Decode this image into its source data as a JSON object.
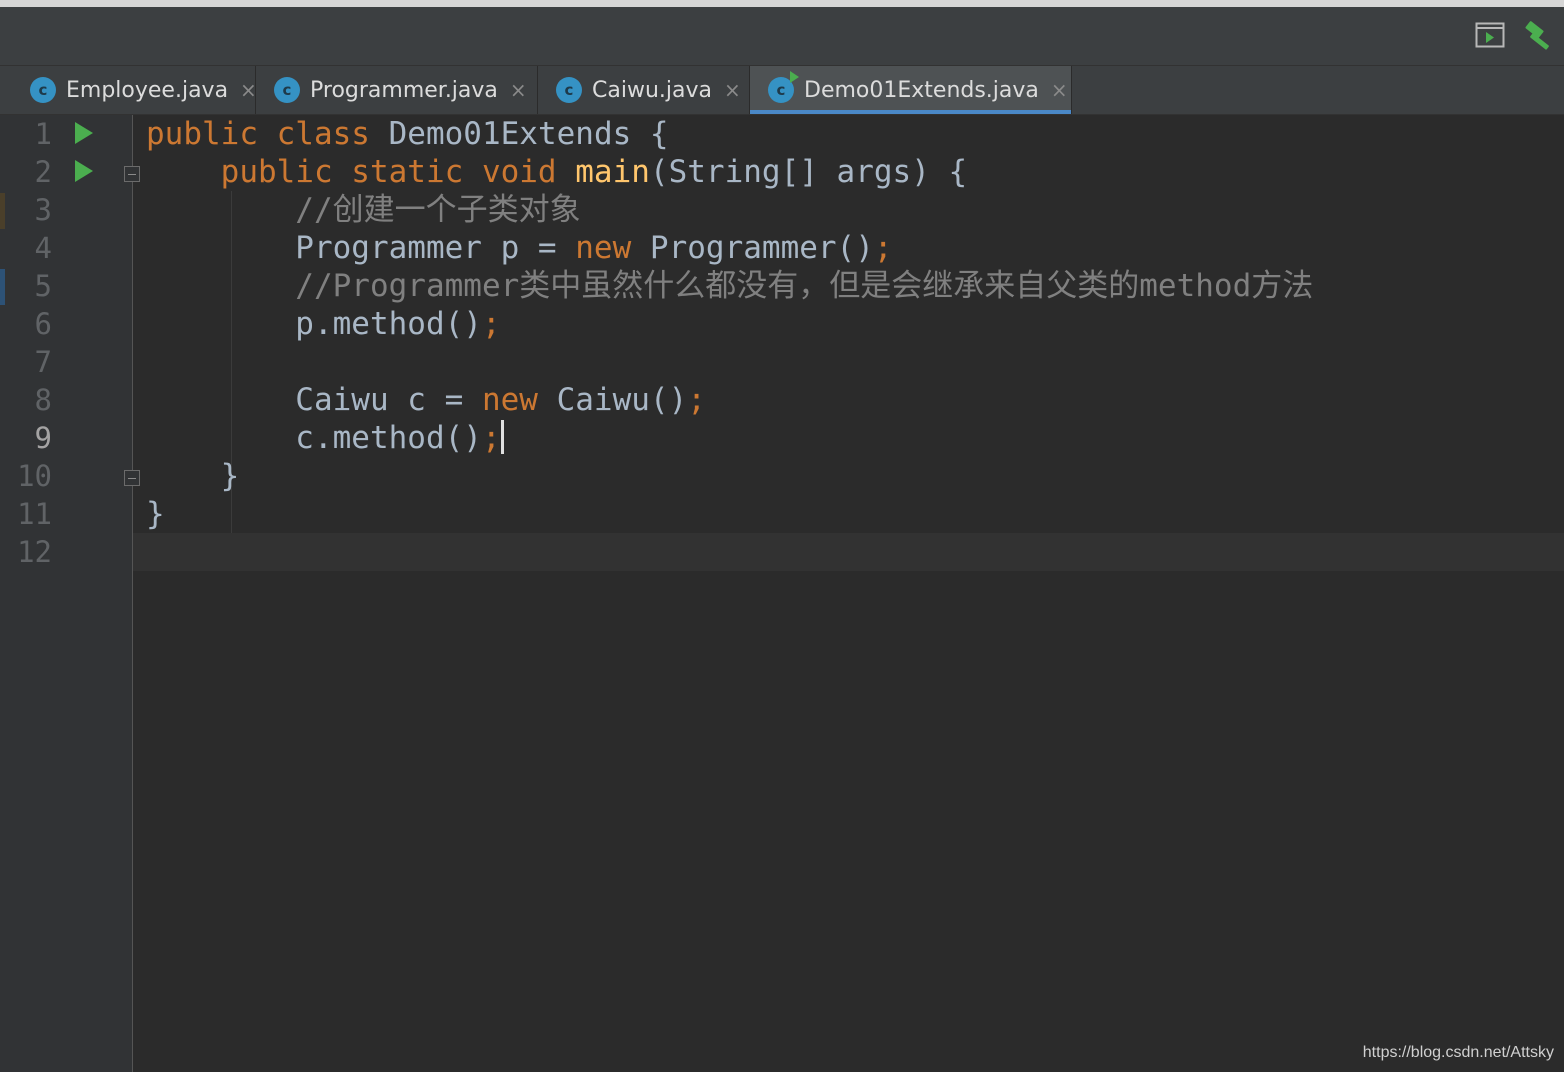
{
  "tabs": [
    {
      "label": "Employee.java",
      "icon": "class-icon",
      "icon_letter": "c",
      "active": false
    },
    {
      "label": "Programmer.java",
      "icon": "class-icon",
      "icon_letter": "c",
      "active": false
    },
    {
      "label": "Caiwu.java",
      "icon": "class-icon",
      "icon_letter": "c",
      "active": false
    },
    {
      "label": "Demo01Extends.java",
      "icon": "runnable-class-icon",
      "icon_letter": "c",
      "active": true
    }
  ],
  "tab_close_glyph": "×",
  "toolbar": {
    "run_icon": "run-configuration-icon",
    "build_icon": "hammer-build-icon"
  },
  "editor": {
    "line_numbers": [
      "1",
      "2",
      "3",
      "4",
      "5",
      "6",
      "7",
      "8",
      "9",
      "10",
      "11",
      "12"
    ],
    "current_line": 9,
    "run_gutter_lines": [
      1,
      2
    ],
    "lines": [
      [
        {
          "t": "kw",
          "v": "public class "
        },
        {
          "t": "id",
          "v": "Demo01Extends {"
        }
      ],
      [
        {
          "t": "id",
          "v": "    "
        },
        {
          "t": "kw",
          "v": "public static void "
        },
        {
          "t": "fn",
          "v": "main"
        },
        {
          "t": "id",
          "v": "(String[] args) {"
        }
      ],
      [
        {
          "t": "cm",
          "v": "        //创建一个子类对象"
        }
      ],
      [
        {
          "t": "id",
          "v": "        Programmer p = "
        },
        {
          "t": "kw",
          "v": "new "
        },
        {
          "t": "id",
          "v": "Programmer()"
        },
        {
          "t": "kw",
          "v": ";"
        }
      ],
      [
        {
          "t": "cm",
          "v": "        //Programmer类中虽然什么都没有，但是会继承来自父类的method方法"
        }
      ],
      [
        {
          "t": "id",
          "v": "        p.method()"
        },
        {
          "t": "kw",
          "v": ";"
        }
      ],
      [
        {
          "t": "id",
          "v": ""
        }
      ],
      [
        {
          "t": "id",
          "v": "        Caiwu c = "
        },
        {
          "t": "kw",
          "v": "new "
        },
        {
          "t": "id",
          "v": "Caiwu()"
        },
        {
          "t": "kw",
          "v": ";"
        }
      ],
      [
        {
          "t": "id",
          "v": "        c.method()"
        },
        {
          "t": "kw",
          "v": ";"
        }
      ],
      [
        {
          "t": "id",
          "v": "    }"
        }
      ],
      [
        {
          "t": "id",
          "v": "}"
        }
      ],
      [
        {
          "t": "id",
          "v": ""
        }
      ]
    ]
  },
  "colors": {
    "keyword": "#cc7832",
    "function": "#ffc66d",
    "comment": "#808080",
    "identifier": "#a9b7c6",
    "background": "#2b2b2b",
    "gutter": "#313335",
    "run_green": "#4bae4f",
    "tab_accent": "#4a88c7"
  },
  "watermark": "https://blog.csdn.net/Attsky"
}
